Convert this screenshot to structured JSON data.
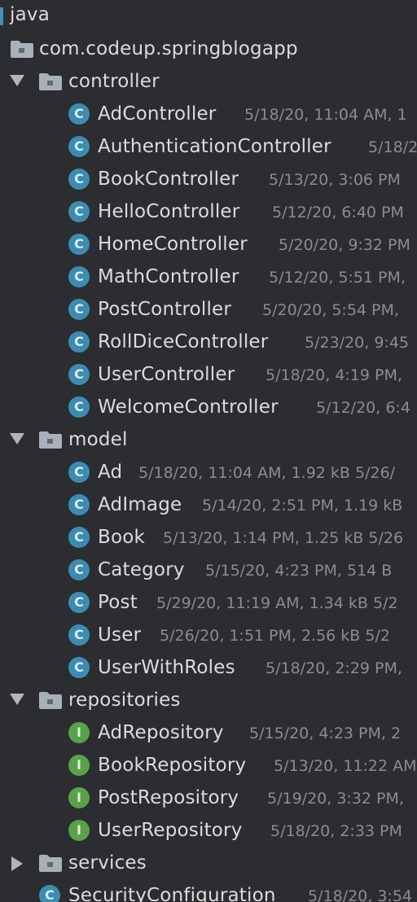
{
  "root": {
    "label": "java"
  },
  "package": {
    "label": "com.codeup.springblogapp"
  },
  "controller": {
    "label": "controller",
    "expanded": true,
    "items": [
      {
        "name": "AdController",
        "meta": "5/18/20, 11:04 AM, 1"
      },
      {
        "name": "AuthenticationController",
        "meta": "5/18/2"
      },
      {
        "name": "BookController",
        "meta": "5/13/20, 3:06 PM"
      },
      {
        "name": "HelloController",
        "meta": "5/12/20, 6:40 PM"
      },
      {
        "name": "HomeController",
        "meta": "5/20/20, 9:32 PM"
      },
      {
        "name": "MathController",
        "meta": "5/12/20, 5:51 PM,"
      },
      {
        "name": "PostController",
        "meta": "5/20/20, 5:54 PM,"
      },
      {
        "name": "RollDiceController",
        "meta": "5/23/20, 9:45"
      },
      {
        "name": "UserController",
        "meta": "5/18/20, 4:19 PM,"
      },
      {
        "name": "WelcomeController",
        "meta": "5/12/20, 6:4"
      }
    ]
  },
  "model": {
    "label": "model",
    "expanded": true,
    "items": [
      {
        "name": "Ad",
        "meta": "5/18/20, 11:04 AM, 1.92 kB 5/26/"
      },
      {
        "name": "AdImage",
        "meta": "5/14/20, 2:51 PM, 1.19 kB"
      },
      {
        "name": "Book",
        "meta": "5/13/20, 1:14 PM, 1.25 kB 5/26"
      },
      {
        "name": "Category",
        "meta": "5/15/20, 4:23 PM, 514 B"
      },
      {
        "name": "Post",
        "meta": "5/29/20, 11:19 AM, 1.34 kB 5/2"
      },
      {
        "name": "User",
        "meta": "5/26/20, 1:51 PM, 2.56 kB 5/2"
      },
      {
        "name": "UserWithRoles",
        "meta": "5/18/20, 2:29 PM,"
      }
    ]
  },
  "repositories": {
    "label": "repositories",
    "expanded": true,
    "items": [
      {
        "name": "AdRepository",
        "meta": "5/15/20, 4:23 PM, 2"
      },
      {
        "name": "BookRepository",
        "meta": "5/13/20, 11:22 AM"
      },
      {
        "name": "PostRepository",
        "meta": "5/19/20, 3:32 PM,"
      },
      {
        "name": "UserRepository",
        "meta": "5/18/20, 2:33 PM"
      }
    ]
  },
  "services": {
    "label": "services",
    "expanded": false
  },
  "security": {
    "name": "SecurityConfiguration",
    "meta": "5/18/20, 3:54"
  },
  "icons": {
    "class_letter": "C",
    "interface_letter": "I",
    "class_color": "#3d8cb0",
    "interface_color": "#5aa14a",
    "folder_color": "#a9b1b8"
  }
}
